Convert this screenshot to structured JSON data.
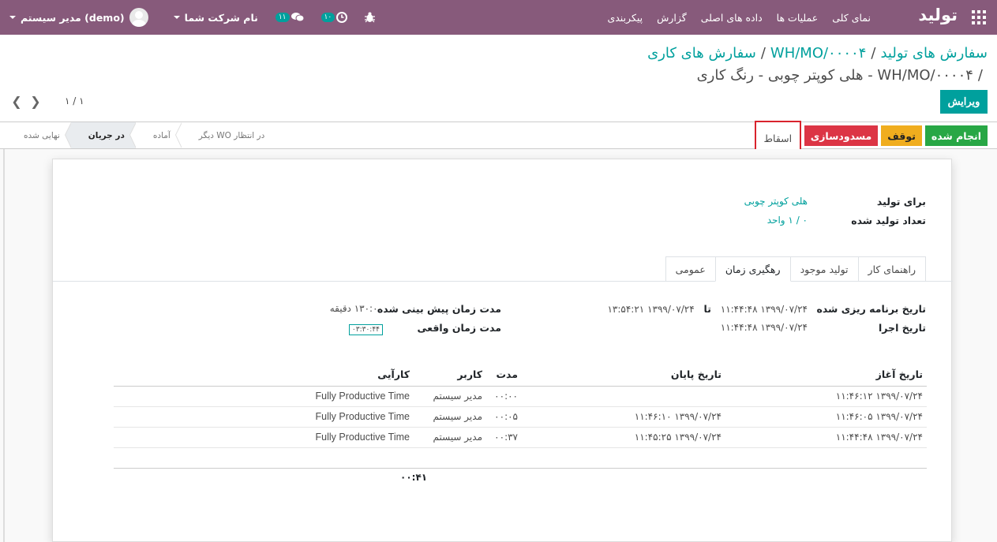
{
  "navbar": {
    "brand": "تولید",
    "menu": [
      "نمای کلی",
      "عملیات ها",
      "داده های اصلی",
      "گزارش",
      "پیکربندی"
    ],
    "user": "مدیر سیستم (demo)",
    "company": "نام شرکت شما",
    "messages_count": "۱۱",
    "activities_count": "۱۰"
  },
  "breadcrumb": {
    "items": [
      "سفارش های تولید",
      "WH/MO/۰۰۰۰۴",
      "سفارش های کاری"
    ],
    "current": "WH/MO/۰۰۰۰۴ - هلی کوپتر چوبی - رنگ کاری"
  },
  "edit_label": "ویرایش",
  "pager": "۱ / ۱",
  "actions": {
    "done": "انجام شده",
    "pause": "توقف",
    "block": "مسدودسازی",
    "scrap": "اسقاط"
  },
  "stages": [
    "در انتظار WO دیگر",
    "آماده",
    "در جریان",
    "نهایی شده"
  ],
  "active_stage": "در جریان",
  "form": {
    "product_label": "برای تولید",
    "product_value": "هلی کوپتر چوبی",
    "qty_label": "تعداد تولید شده",
    "qty_value": "۰ / ۱ واحد"
  },
  "tabs": [
    "راهنمای کار",
    "تولید موجود",
    "رهگیری زمان",
    "عمومی"
  ],
  "active_tab": "رهگیری زمان",
  "time": {
    "planned_label": "تاریخ برنامه ریزی شده",
    "planned_from": "۱۳۹۹/۰۷/۲۴ ۱۱:۴۴:۴۸",
    "to_label": "تا",
    "planned_to": "۱۳۹۹/۰۷/۲۴ ۱۳:۵۴:۲۱",
    "exec_label": "تاریخ اجرا",
    "exec_value": "۱۳۹۹/۰۷/۲۴ ۱۱:۴۴:۴۸",
    "expected_label": "مدت زمان پیش بینی شده",
    "expected_value": "۱۳۰:۰۰ دقیقه",
    "real_label": "مدت زمان واقعی",
    "real_value": "۰۳:۳۰:۴۴"
  },
  "table": {
    "headers": [
      "تاریخ آغاز",
      "تاریخ پایان",
      "مدت",
      "کاربر",
      "کارآیی"
    ],
    "rows": [
      {
        "start": "۱۳۹۹/۰۷/۲۴ ۱۱:۴۶:۱۲",
        "end": "",
        "duration": "۰۰:۰۰",
        "user": "مدیر سیستم",
        "efficiency": "Fully Productive Time"
      },
      {
        "start": "۱۳۹۹/۰۷/۲۴ ۱۱:۴۶:۰۵",
        "end": "۱۳۹۹/۰۷/۲۴ ۱۱:۴۶:۱۰",
        "duration": "۰۰:۰۵",
        "user": "مدیر سیستم",
        "efficiency": "Fully Productive Time"
      },
      {
        "start": "۱۳۹۹/۰۷/۲۴ ۱۱:۴۴:۴۸",
        "end": "۱۳۹۹/۰۷/۲۴ ۱۱:۴۵:۲۵",
        "duration": "۰۰:۳۷",
        "user": "مدیر سیستم",
        "efficiency": "Fully Productive Time"
      }
    ],
    "total": "۰۰:۴۱"
  }
}
